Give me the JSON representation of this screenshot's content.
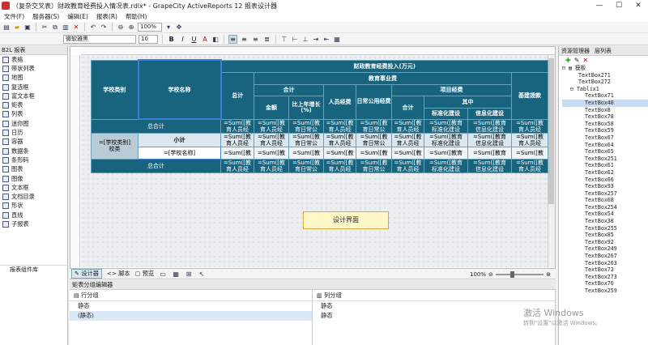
{
  "titlebar": {
    "title": "（复杂交叉表）财政教育经费投入情况表.rdlx* - GrapeCity ActiveReports 12 报表设计器",
    "min": "—",
    "max": "☐",
    "close": "✕"
  },
  "menu": [
    "文件(F)",
    "服务器(S)",
    "编辑(E)",
    "报表(R)",
    "帮助(H)"
  ],
  "toolbar": {
    "zoom": "100%",
    "font": "微软雅黑",
    "size": "10",
    "bold": "B",
    "italic": "I",
    "underline": "U"
  },
  "left": {
    "header": "B2L 报表",
    "items": [
      "表格",
      "带状列表",
      "地图",
      "复选框",
      "富文本框",
      "矩表",
      "列表",
      "迷你图",
      "日历",
      "容器",
      "数据条",
      "条形码",
      "图表",
      "图像",
      "文本框",
      "文档目录",
      "形状",
      "直线",
      "子报表"
    ],
    "library": "报表组件库"
  },
  "report": {
    "header": {
      "col_type": "学校类别",
      "col_name": "学校名称",
      "main_title": "财政教育经费投入(万元)",
      "total": "总计",
      "edu": "教育事业费",
      "sum": "合计",
      "amount": "金额",
      "growth": "比上年增长(%)",
      "personnel": "人员经费",
      "daily": "日常公用经费",
      "project": "项目经费",
      "proj_sum": "合计",
      "among": "其中",
      "std": "标准化建设",
      "info": "信息化建设",
      "infra": "基建拨款"
    },
    "total_row": "总合计",
    "subtotal": "小计",
    "school_field": "=[学校名称]",
    "type_field": "=[学校类别]",
    "type_field_short": "校类",
    "cell_sum": "=Sum([教",
    "cell_sum2": "=Sum([教育",
    "cell_expr_a": "育人员经",
    "cell_expr_b": "标准化建设",
    "cell_expr_c": "信息化建设",
    "cell_expr_d": "育日常公"
  },
  "tooltip": "设计界面",
  "bottom_tabs": {
    "design": "设计器",
    "script": "脚本",
    "preview": "预览"
  },
  "zoom": "100%",
  "group_editor": {
    "title": "矩表分组编辑器",
    "rows": "行分组",
    "cols": "列分组",
    "static1": "静态",
    "static2": "(静态)",
    "static3": "静态",
    "static4": "静态"
  },
  "right": {
    "tabs": [
      "资源管理器",
      "层列表"
    ],
    "root": "模板",
    "nodes": [
      "TextBox271",
      "TextBox272",
      "Tablix1",
      "TextBox71",
      "TextBox40",
      "TextBox8",
      "TextBox78",
      "TextBox58",
      "TextBox59",
      "TextBox67",
      "TextBox64",
      "TextBox65",
      "TextBox251",
      "TextBox61",
      "TextBox62",
      "TextBox66",
      "TextBox93",
      "TextBox257",
      "TextBox68",
      "TextBox254",
      "TextBox54",
      "TextBox38",
      "TextBox255",
      "TextBox85",
      "TextBox92",
      "TextBox249",
      "TextBox267",
      "TextBox263",
      "TextBox72",
      "TextBox273",
      "TextBox76",
      "TextBox259"
    ]
  },
  "watermark": {
    "line1": "激活 Windows",
    "line2": "转到\"设置\"以激活 Windows。"
  }
}
